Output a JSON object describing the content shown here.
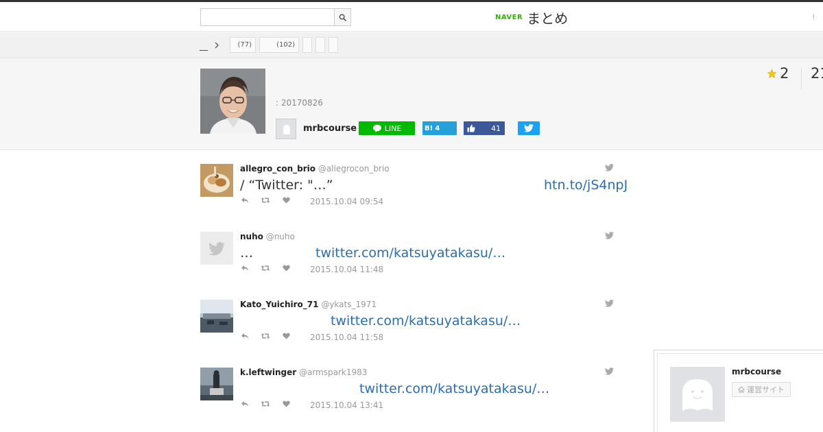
{
  "header": {
    "search_placeholder": "",
    "logo_brand": "NAVER",
    "logo_service": "まとめ",
    "right_mark": "!"
  },
  "breadcrumb": {
    "home_label": "__",
    "tags": [
      {
        "label": "(77)"
      },
      {
        "label": "(102)"
      },
      {
        "label": ""
      },
      {
        "label": ""
      },
      {
        "label": ""
      }
    ]
  },
  "article": {
    "date": ": 20170826",
    "author": "mrbcourse",
    "favorites": "2",
    "views": "21",
    "share": {
      "line_label": "LINE",
      "hatena_label": "B!",
      "hatena_count": "4",
      "facebook_count": "41"
    }
  },
  "tweets": [
    {
      "user": "allegro_con_brio",
      "handle": "@allegrocon_brio",
      "text": " / “Twitter: \"…”",
      "link": "htn.to/jS4npJ",
      "time": "2015.10.04 09:54",
      "avatar_icon": "food-photo"
    },
    {
      "user": "nuho",
      "handle": "@nuho",
      "text": "…",
      "link": "twitter.com/katsuyatakasu/…",
      "time": "2015.10.04 11:48",
      "avatar_icon": "twitter-bird-icon"
    },
    {
      "user": "Kato_Yuichiro_71",
      "handle": "@ykats_1971",
      "text": "",
      "link": "twitter.com/katsuyatakasu/…",
      "time": "2015.10.04 11:58",
      "avatar_icon": "landscape-photo"
    },
    {
      "user": "k.leftwinger",
      "handle": "@armspark1983",
      "text": "",
      "link": "twitter.com/katsuyatakasu/…",
      "time": "2015.10.04 13:41",
      "avatar_icon": "statue-photo"
    }
  ],
  "profile_card": {
    "name": "mrbcourse",
    "site_button_label": "運営サイト"
  },
  "colors": {
    "naver_green": "#2db400",
    "line_green": "#00b900",
    "hatena_blue": "#26a0da",
    "facebook_blue": "#3b5998",
    "twitter_blue": "#1da1f2",
    "link_blue": "#2b6dad"
  }
}
